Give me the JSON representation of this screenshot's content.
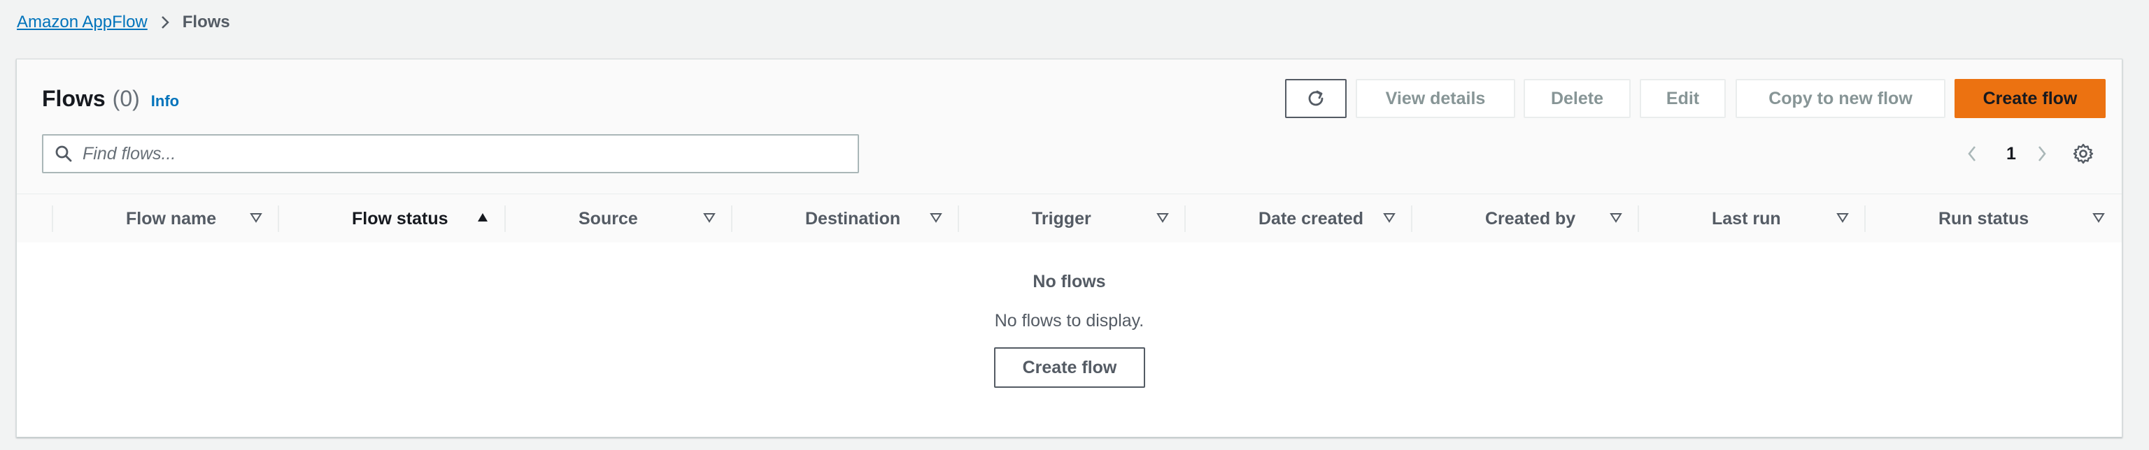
{
  "breadcrumb": {
    "root": "Amazon AppFlow",
    "current": "Flows"
  },
  "header": {
    "title": "Flows",
    "count": "(0)",
    "info": "Info"
  },
  "toolbar": {
    "refresh_icon": "refresh-icon",
    "view_details": "View details",
    "delete": "Delete",
    "edit": "Edit",
    "copy": "Copy to new flow",
    "create": "Create flow"
  },
  "search": {
    "placeholder": "Find flows...",
    "value": ""
  },
  "pagination": {
    "page": "1"
  },
  "table": {
    "columns": [
      {
        "label": "Flow name",
        "sort": "none"
      },
      {
        "label": "Flow status",
        "sort": "ascending"
      },
      {
        "label": "Source",
        "sort": "none"
      },
      {
        "label": "Destination",
        "sort": "none"
      },
      {
        "label": "Trigger",
        "sort": "none"
      },
      {
        "label": "Date created",
        "sort": "none"
      },
      {
        "label": "Created by",
        "sort": "none"
      },
      {
        "label": "Last run",
        "sort": "none"
      },
      {
        "label": "Run status",
        "sort": "none"
      }
    ]
  },
  "empty_state": {
    "title": "No flows",
    "description": "No flows to display.",
    "button": "Create flow"
  },
  "colors": {
    "accent": "#ec7211",
    "link": "#0073bb"
  }
}
